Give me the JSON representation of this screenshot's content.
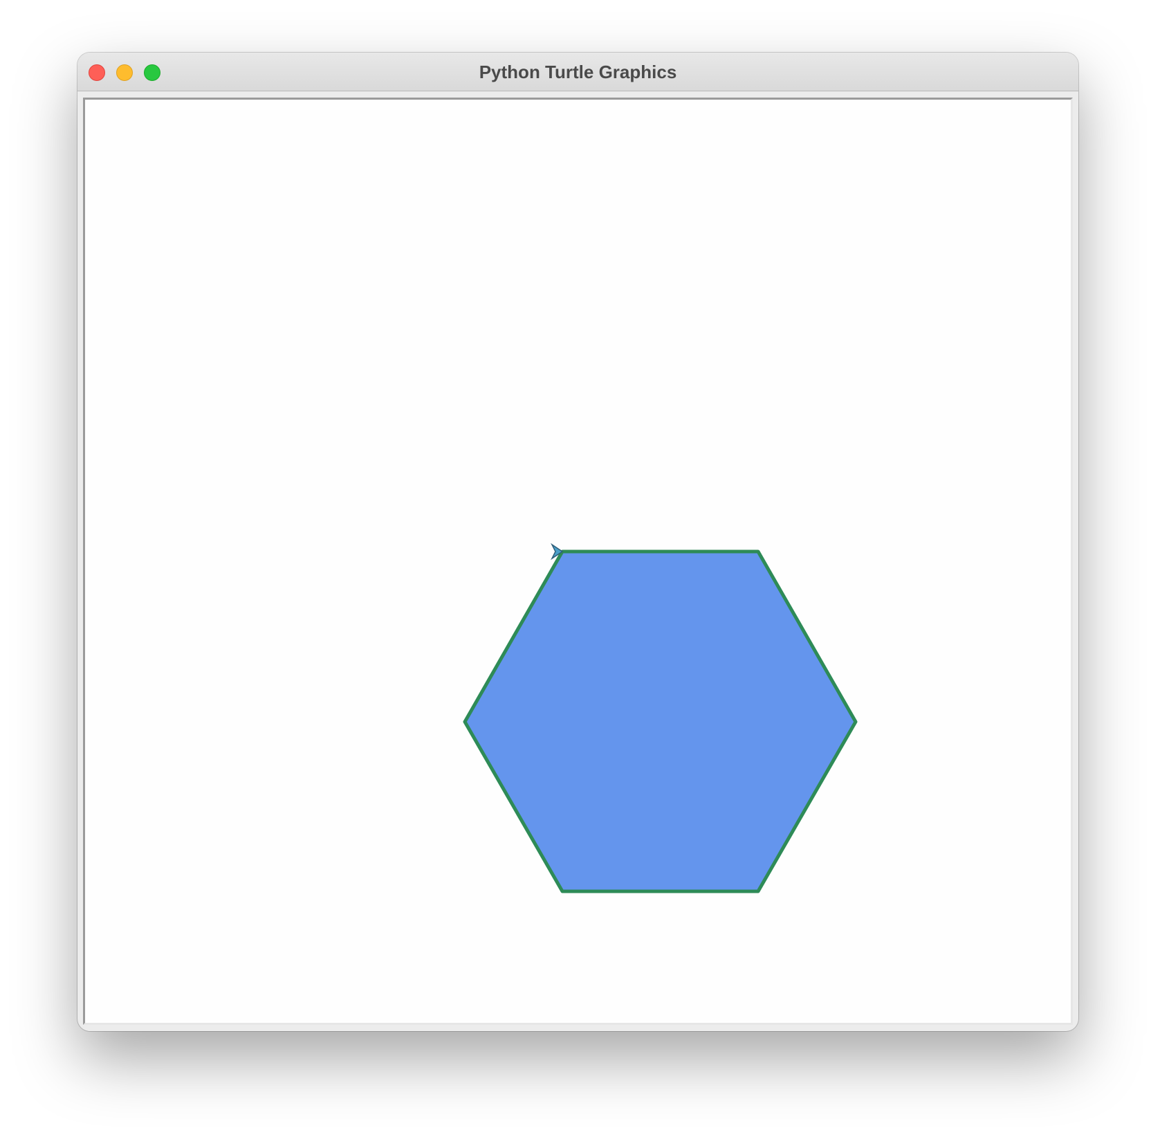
{
  "window": {
    "title": "Python Turtle Graphics"
  },
  "controls": {
    "close": "close-button",
    "minimize": "minimize-button",
    "maximize": "maximize-button"
  },
  "drawing": {
    "shape": "hexagon",
    "fill_color": "#6495ED",
    "stroke_color": "#2E8B57",
    "turtle_icon": "turtle-arrow-icon",
    "turtle_color": "#4a9fc8"
  }
}
